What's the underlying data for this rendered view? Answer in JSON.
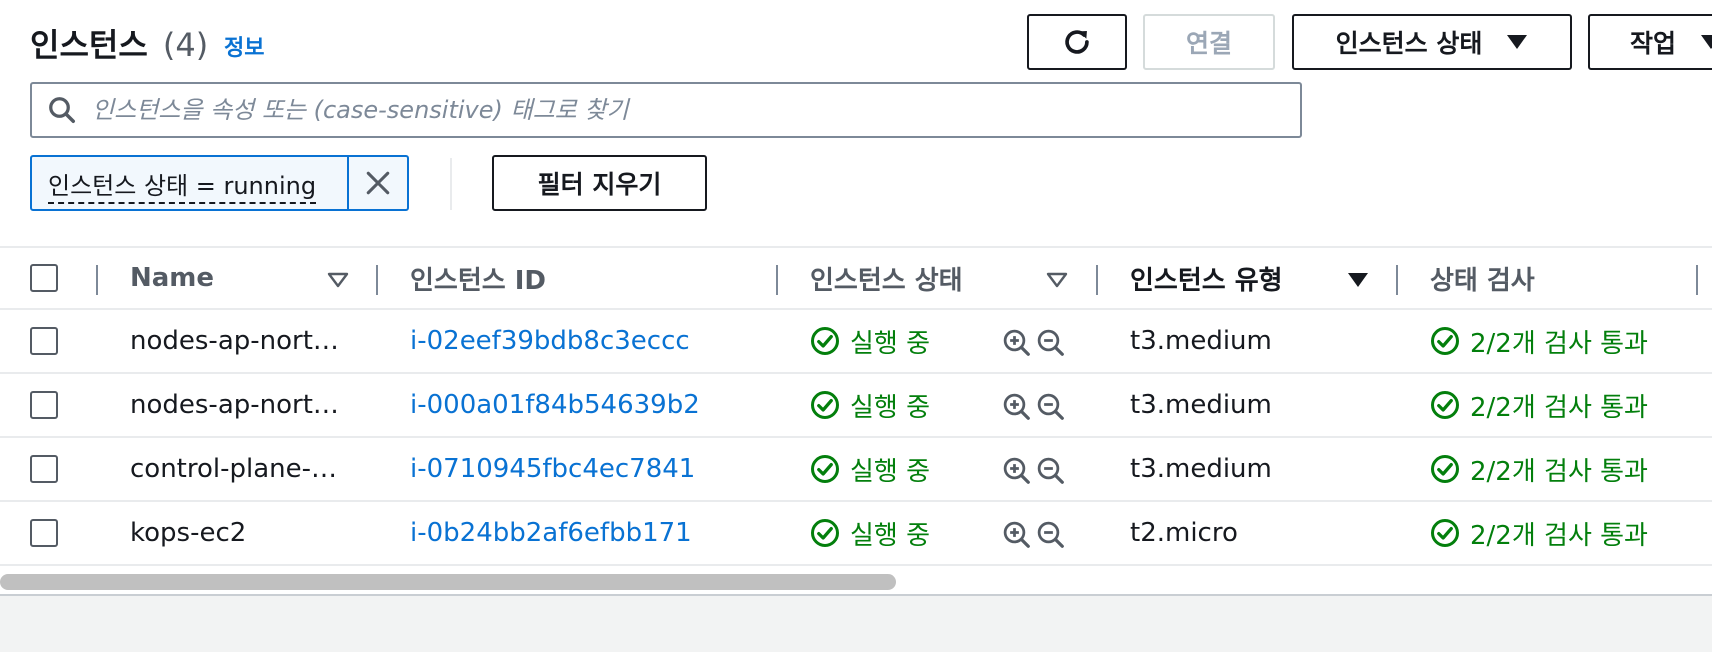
{
  "header": {
    "title": "인스턴스",
    "count": "(4)",
    "info_link": "정보",
    "connect_label": "연결",
    "state_label": "인스턴스 상태",
    "actions_label": "작업"
  },
  "search": {
    "placeholder": "인스턴스을 속성 또는 (case-sensitive) 태그로 찾기"
  },
  "filter": {
    "token_label": "인스턴스 상태 = running",
    "clear_label": "필터 지우기"
  },
  "table": {
    "columns": {
      "name": "Name",
      "instance_id": "인스턴스 ID",
      "instance_state": "인스턴스 상태",
      "instance_type": "인스턴스 유형",
      "status_check": "상태 검사"
    },
    "rows": [
      {
        "name": "nodes-ap-nort…",
        "id": "i-02eef39bdb8c3eccc",
        "state": "실행 중",
        "type": "t3.medium",
        "check": "2/2개 검사 통과"
      },
      {
        "name": "nodes-ap-nort…",
        "id": "i-000a01f84b54639b2",
        "state": "실행 중",
        "type": "t3.medium",
        "check": "2/2개 검사 통과"
      },
      {
        "name": "control-plane-…",
        "id": "i-0710945fbc4ec7841",
        "state": "실행 중",
        "type": "t3.medium",
        "check": "2/2개 검사 통과"
      },
      {
        "name": "kops-ec2",
        "id": "i-0b24bb2af6efbb171",
        "state": "실행 중",
        "type": "t2.micro",
        "check": "2/2개 검사 통과"
      }
    ]
  },
  "icons": {
    "refresh": "refresh-icon",
    "search": "search-icon",
    "close": "close-icon",
    "status_ok": "check-circle-icon",
    "zoom_in": "zoom-in-icon",
    "zoom_out": "zoom-out-icon"
  },
  "colors": {
    "link": "#0972d3",
    "success": "#037f0c",
    "text": "#16191f"
  }
}
